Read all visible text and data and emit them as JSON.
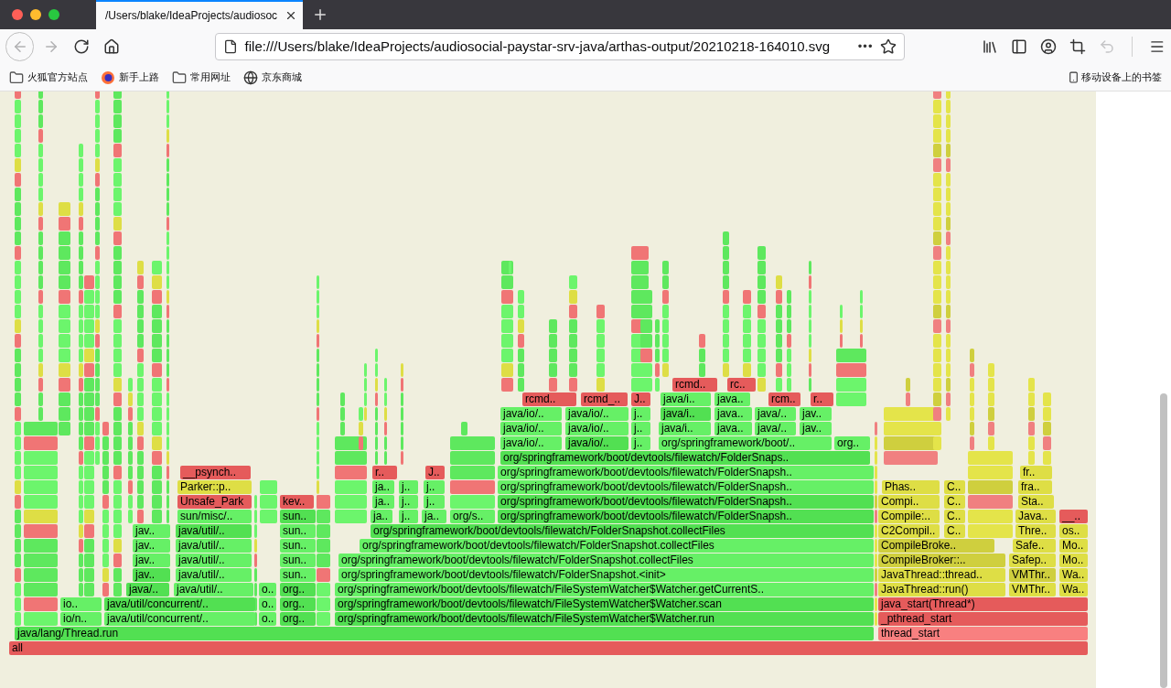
{
  "browser": {
    "tabs": [
      {
        "title": "/Users/blake/IdeaProjects/audiosoc",
        "selected": true
      }
    ],
    "nav_buttons": [
      {
        "kind": "back",
        "disabled": true
      },
      {
        "kind": "forward",
        "disabled": true
      },
      {
        "kind": "reload",
        "disabled": false
      },
      {
        "kind": "home",
        "disabled": false
      }
    ],
    "url": "file:///Users/blake/IdeaProjects/audiosocial-paystar-srv-java/arthas-output/20210218-164010.svg",
    "page_actions": "•••",
    "toolbar": [
      {
        "kind": "library",
        "disabled": false
      },
      {
        "kind": "sidebar",
        "disabled": false
      },
      {
        "kind": "account",
        "disabled": false
      },
      {
        "kind": "screenshot",
        "disabled": false
      },
      {
        "kind": "undo",
        "disabled": true
      }
    ],
    "bookmarks": [
      {
        "label": "火狐官方站点",
        "kind": "folder"
      },
      {
        "label": "新手上路",
        "kind": "firefox"
      },
      {
        "label": "常用网址",
        "kind": "folder"
      },
      {
        "label": "京东商城",
        "kind": "globe"
      }
    ],
    "mobile_bookmarks": "移动设备上的书签"
  },
  "flame_graph": {
    "rows": [
      {
        "frames": [
          {
            "label": "rcmd..",
            "color": "#e55b5b"
          },
          {
            "label": "rc..",
            "color": "#e55b5b"
          }
        ]
      },
      {
        "frames": [
          {
            "label": "rcmd..",
            "color": "#e55b5b"
          },
          {
            "label": "rcmd_..",
            "color": "#e55b5b"
          },
          {
            "label": "J..",
            "color": "#e55b5b"
          },
          {
            "label": "java/i..",
            "color": "#66f066"
          },
          {
            "label": "java..",
            "color": "#66f066"
          },
          {
            "label": "rcm..",
            "color": "#e55b5b"
          },
          {
            "label": "r..",
            "color": "#e55b5b"
          }
        ]
      },
      {
        "frames": [
          {
            "label": "java/io/..",
            "color": "#66f066"
          },
          {
            "label": "java/io/..",
            "color": "#66f066"
          },
          {
            "label": "j..",
            "color": "#66f066"
          },
          {
            "label": "java/i..",
            "color": "#52e052"
          },
          {
            "label": "java..",
            "color": "#66f066"
          },
          {
            "label": "java/..",
            "color": "#66f066"
          },
          {
            "label": "jav..",
            "color": "#66f066"
          }
        ]
      },
      {
        "frames": [
          {
            "label": "java/io/..",
            "color": "#66f066"
          },
          {
            "label": "java/io/..",
            "color": "#66f066"
          },
          {
            "label": "j..",
            "color": "#66f066"
          },
          {
            "label": "java/i..",
            "color": "#66f066"
          },
          {
            "label": "java..",
            "color": "#66f066"
          },
          {
            "label": "java/..",
            "color": "#66f066"
          },
          {
            "label": "jav..",
            "color": "#66f066"
          }
        ]
      },
      {
        "frames": [
          {
            "label": "java/io/..",
            "color": "#66f066"
          },
          {
            "label": "java/io/..",
            "color": "#52e052"
          },
          {
            "label": "j..",
            "color": "#66f066"
          },
          {
            "label": "org/springframework/boot/..",
            "color": "#66f066"
          },
          {
            "label": "org..",
            "color": "#66f066"
          }
        ]
      },
      {
        "frames": [
          {
            "label": "org/springframework/boot/devtools/filewatch/FolderSnaps..",
            "color": "#52e052"
          }
        ]
      },
      {
        "frames": [
          {
            "label": "__psynch..",
            "color": "#e55b5b"
          },
          {
            "label": "r..",
            "color": "#e55b5b"
          },
          {
            "label": "J..",
            "color": "#e55b5b"
          },
          {
            "label": "org/springframework/boot/devtools/filewatch/FolderSnapsh..",
            "color": "#66f066"
          },
          {
            "label": "fr..",
            "color": "#dede45"
          }
        ]
      },
      {
        "frames": [
          {
            "label": "Parker::p..",
            "color": "#dede45"
          },
          {
            "label": "ja..",
            "color": "#66f066"
          },
          {
            "label": "j..",
            "color": "#66f066"
          },
          {
            "label": "j..",
            "color": "#66f066"
          },
          {
            "label": "org/springframework/boot/devtools/filewatch/FolderSnapsh..",
            "color": "#66f066"
          },
          {
            "label": "Phas..",
            "color": "#dede45"
          },
          {
            "label": "C..",
            "color": "#dede45"
          },
          {
            "label": "fra..",
            "color": "#dede45"
          }
        ]
      },
      {
        "frames": [
          {
            "label": "Unsafe_Park",
            "color": "#e55b5b"
          },
          {
            "label": "kev..",
            "color": "#e55b5b"
          },
          {
            "label": "ja..",
            "color": "#66f066"
          },
          {
            "label": "j..",
            "color": "#66f066"
          },
          {
            "label": "j..",
            "color": "#66f066"
          },
          {
            "label": "org/springframework/boot/devtools/filewatch/FolderSnapsh..",
            "color": "#52e052"
          },
          {
            "label": "Compi..",
            "color": "#dede45"
          },
          {
            "label": "C..",
            "color": "#dede45"
          },
          {
            "label": "Sta..",
            "color": "#dede45"
          }
        ]
      },
      {
        "frames": [
          {
            "label": "sun/misc/..",
            "color": "#66f066"
          },
          {
            "label": "sun..",
            "color": "#52e052"
          },
          {
            "label": "ja..",
            "color": "#66f066"
          },
          {
            "label": "j..",
            "color": "#66f066"
          },
          {
            "label": "ja..",
            "color": "#66f066"
          },
          {
            "label": "org/s..",
            "color": "#66f066"
          },
          {
            "label": "org/springframework/boot/devtools/filewatch/FolderSnapsh..",
            "color": "#52e052"
          },
          {
            "label": "Compile:..",
            "color": "#dede45"
          },
          {
            "label": "C..",
            "color": "#dede45"
          },
          {
            "label": "Java..",
            "color": "#dede45"
          },
          {
            "label": "__..",
            "color": "#e55b5b"
          }
        ]
      },
      {
        "frames": [
          {
            "label": "jav..",
            "color": "#66f066"
          },
          {
            "label": "java/util/..",
            "color": "#52e052"
          },
          {
            "label": "sun..",
            "color": "#66f066"
          },
          {
            "label": "org/springframework/boot/devtools/filewatch/FolderSnapshot.collectFiles",
            "color": "#52e052"
          },
          {
            "label": "C2Compil..",
            "color": "#dede45"
          },
          {
            "label": "C..",
            "color": "#dede45"
          },
          {
            "label": "Thre..",
            "color": "#dede45"
          },
          {
            "label": "os..",
            "color": "#dede45"
          }
        ]
      },
      {
        "frames": [
          {
            "label": "jav..",
            "color": "#66f066"
          },
          {
            "label": "java/util/..",
            "color": "#66f066"
          },
          {
            "label": "sun..",
            "color": "#66f066"
          },
          {
            "label": "org/springframework/boot/devtools/filewatch/FolderSnapshot.collectFiles",
            "color": "#66f066"
          },
          {
            "label": "CompileBroke..",
            "color": "#cfcf3e"
          },
          {
            "label": "Safe..",
            "color": "#dede45"
          },
          {
            "label": "Mo..",
            "color": "#dede45"
          }
        ]
      },
      {
        "frames": [
          {
            "label": "jav..",
            "color": "#66f066"
          },
          {
            "label": "java/util/..",
            "color": "#66f066"
          },
          {
            "label": "sun..",
            "color": "#66f066"
          },
          {
            "label": "org/springframework/boot/devtools/filewatch/FolderSnapshot.collectFiles",
            "color": "#66f066"
          },
          {
            "label": "CompileBroker::..",
            "color": "#cfcf3e"
          },
          {
            "label": "Safep..",
            "color": "#dede45"
          },
          {
            "label": "Mo..",
            "color": "#dede45"
          }
        ]
      },
      {
        "frames": [
          {
            "label": "jav..",
            "color": "#52e052"
          },
          {
            "label": "java/util/..",
            "color": "#66f066"
          },
          {
            "label": "sun..",
            "color": "#66f066"
          },
          {
            "label": "org/springframework/boot/devtools/filewatch/FolderSnapshot.<init>",
            "color": "#66f066"
          },
          {
            "label": "JavaThread::thread..",
            "color": "#dede45"
          },
          {
            "label": "VMThr..",
            "color": "#cfcf3e"
          },
          {
            "label": "Wa..",
            "color": "#dede45"
          }
        ]
      },
      {
        "frames": [
          {
            "label": "java/..",
            "color": "#52e052"
          },
          {
            "label": "java/util/..",
            "color": "#66f066"
          },
          {
            "label": "o..",
            "color": "#66f066"
          },
          {
            "label": "org..",
            "color": "#52e052"
          },
          {
            "label": "org/springframework/boot/devtools/filewatch/FileSystemWatcher$Watcher.getCurrentS..",
            "color": "#66f066"
          },
          {
            "label": "JavaThread::run()",
            "color": "#dede45"
          },
          {
            "label": "VMThr..",
            "color": "#dede45"
          },
          {
            "label": "Wa..",
            "color": "#dede45"
          }
        ]
      },
      {
        "frames": [
          {
            "label": "io..",
            "color": "#66f066"
          },
          {
            "label": "java/util/concurrent/..",
            "color": "#52e052"
          },
          {
            "label": "o..",
            "color": "#66f066"
          },
          {
            "label": "org..",
            "color": "#52e052"
          },
          {
            "label": "org/springframework/boot/devtools/filewatch/FileSystemWatcher$Watcher.scan",
            "color": "#52e052"
          },
          {
            "label": "java_start(Thread*)",
            "color": "#e55b5b"
          }
        ]
      },
      {
        "frames": [
          {
            "label": "io/n..",
            "color": "#66f066"
          },
          {
            "label": "java/util/concurrent/..",
            "color": "#66f066"
          },
          {
            "label": "o..",
            "color": "#66f066"
          },
          {
            "label": "org..",
            "color": "#52e052"
          },
          {
            "label": "org/springframework/boot/devtools/filewatch/FileSystemWatcher$Watcher.run",
            "color": "#52e052"
          },
          {
            "label": "_pthread_start",
            "color": "#e55b5b"
          }
        ]
      },
      {
        "frames": [
          {
            "label": "java/lang/Thread.run",
            "color": "#52e052"
          },
          {
            "label": "thread_start",
            "color": "#f88080"
          }
        ]
      },
      {
        "frames": [
          {
            "label": "all",
            "color": "#e55b5b"
          }
        ]
      }
    ]
  }
}
